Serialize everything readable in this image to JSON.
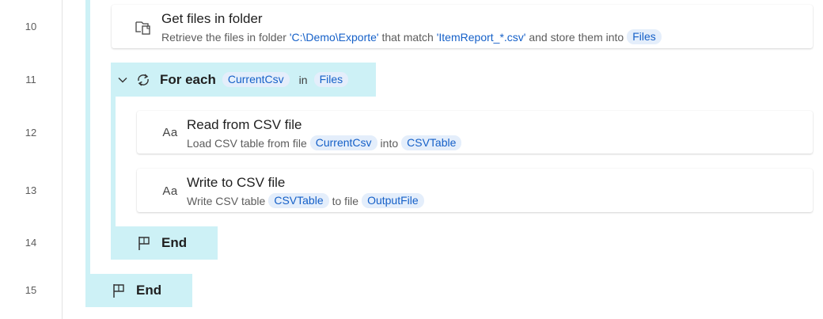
{
  "line_numbers": [
    "10",
    "11",
    "12",
    "13",
    "14",
    "15"
  ],
  "actions": {
    "get_files": {
      "title": "Get files in folder",
      "desc_prefix": "Retrieve the files in folder ",
      "folder": "'C:\\Demo\\Exporte'",
      "desc_mid": " that match ",
      "pattern": "'ItemReport_*.csv'",
      "desc_mid2": " and store them into",
      "output_var": "Files"
    },
    "for_each": {
      "label": "For each",
      "iter_var": "CurrentCsv",
      "keyword": "in",
      "collection_var": "Files"
    },
    "read_csv": {
      "icon_text": "Aa",
      "title": "Read from CSV file",
      "desc_prefix": "Load CSV table from file",
      "file_var": "CurrentCsv",
      "desc_mid": "into",
      "output_var": "CSVTable"
    },
    "write_csv": {
      "icon_text": "Aa",
      "title": "Write to CSV file",
      "desc_prefix": "Write CSV table",
      "table_var": "CSVTable",
      "desc_mid": "to file",
      "file_var": "OutputFile"
    },
    "end_inner": {
      "label": "End"
    },
    "end_outer": {
      "label": "End"
    }
  },
  "colors": {
    "block_highlight": "#cdf1f6",
    "variable_token_bg": "#e4eefb",
    "variable_token_text": "#1560c8"
  },
  "icons": {
    "get_files": "folder-files-icon",
    "for_each": "loop-icon",
    "read_csv": "text-aa-icon",
    "write_csv": "text-aa-icon",
    "end": "flag-icon",
    "collapse": "chevron-down-icon"
  }
}
